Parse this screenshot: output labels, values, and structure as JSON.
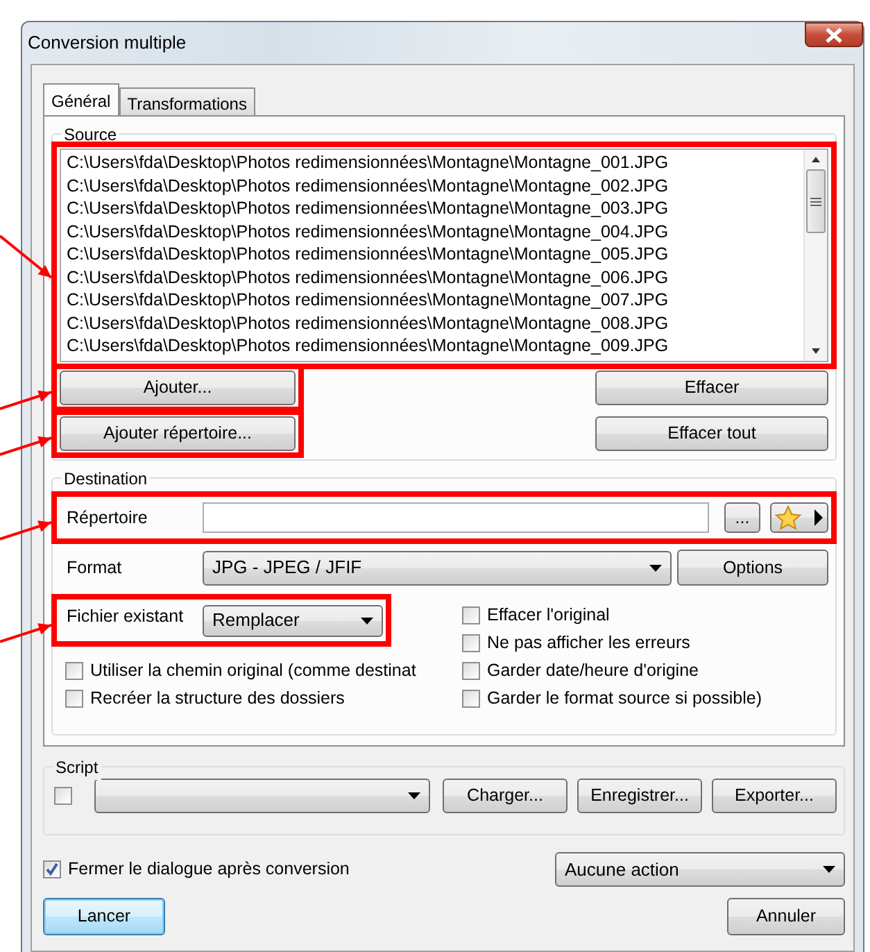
{
  "window": {
    "title": "Conversion multiple"
  },
  "tabs": [
    {
      "label": "Général",
      "selected": true
    },
    {
      "label": "Transformations",
      "selected": false
    }
  ],
  "source": {
    "title": "Source",
    "highlighted": true,
    "files": [
      "C:\\Users\\fda\\Desktop\\Photos redimensionnées\\Montagne\\Montagne_001.JPG",
      "C:\\Users\\fda\\Desktop\\Photos redimensionnées\\Montagne\\Montagne_002.JPG",
      "C:\\Users\\fda\\Desktop\\Photos redimensionnées\\Montagne\\Montagne_003.JPG",
      "C:\\Users\\fda\\Desktop\\Photos redimensionnées\\Montagne\\Montagne_004.JPG",
      "C:\\Users\\fda\\Desktop\\Photos redimensionnées\\Montagne\\Montagne_005.JPG",
      "C:\\Users\\fda\\Desktop\\Photos redimensionnées\\Montagne\\Montagne_006.JPG",
      "C:\\Users\\fda\\Desktop\\Photos redimensionnées\\Montagne\\Montagne_007.JPG",
      "C:\\Users\\fda\\Desktop\\Photos redimensionnées\\Montagne\\Montagne_008.JPG",
      "C:\\Users\\fda\\Desktop\\Photos redimensionnées\\Montagne\\Montagne_009.JPG"
    ],
    "left_buttons": [
      {
        "label": "Ajouter...",
        "highlighted": true
      },
      {
        "label": "Ajouter répertoire...",
        "highlighted": true
      }
    ],
    "right_buttons": [
      {
        "label": "Effacer"
      },
      {
        "label": "Effacer tout"
      }
    ]
  },
  "destination": {
    "title": "Destination",
    "directory": {
      "label": "Répertoire",
      "highlighted": true,
      "browse_button": "..."
    },
    "format": {
      "label": "Format",
      "value": "JPG - JPEG / JFIF",
      "button": "Options"
    },
    "existing_file": {
      "label": "Fichier existant",
      "value": "Remplacer",
      "highlighted": true
    },
    "options_left": [
      {
        "label": "Utiliser la chemin original (comme destinat",
        "checked": false
      },
      {
        "label": "Recréer la structure des dossiers",
        "checked": false
      }
    ],
    "options_right": [
      {
        "label": "Effacer l'original",
        "checked": false
      },
      {
        "label": "Ne pas afficher les erreurs",
        "checked": false
      },
      {
        "label": "Garder date/heure d'origine",
        "checked": false
      },
      {
        "label": "Garder le format source si possible)",
        "checked": false
      }
    ]
  },
  "script": {
    "title": "Script",
    "checked": false,
    "buttons": [
      "Charger...",
      "Enregistrer...",
      "Exporter..."
    ]
  },
  "footer": {
    "close_after": {
      "label": "Fermer le dialogue après conversion",
      "checked": true
    },
    "action": "Aucune action",
    "buttons": [
      {
        "label": "Lancer",
        "default": true
      },
      {
        "label": "Annuler",
        "default": false
      }
    ]
  }
}
